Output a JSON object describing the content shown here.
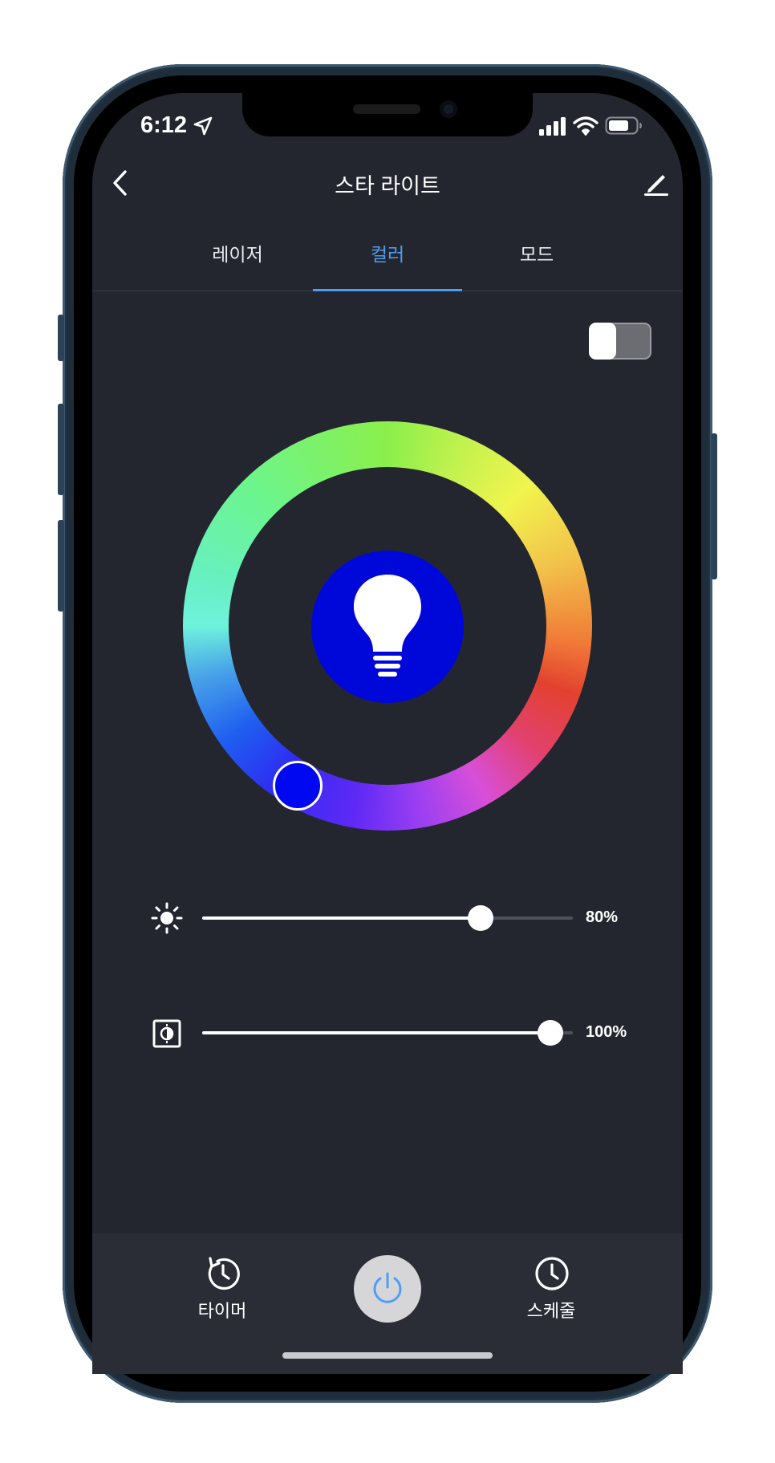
{
  "status_bar": {
    "time": "6:12"
  },
  "header": {
    "title": "스타 라이트"
  },
  "tabs": [
    {
      "label": "레이저",
      "active": false
    },
    {
      "label": "컬러",
      "active": true
    },
    {
      "label": "모드",
      "active": false
    }
  ],
  "power_toggle": {
    "on": false
  },
  "color_wheel": {
    "selected_color": "#0008f2",
    "bulb_color": "#0008d9"
  },
  "brightness": {
    "value": 0.8,
    "label": "80%"
  },
  "contrast": {
    "value": 1.0,
    "label": "100%"
  },
  "bottom_nav": {
    "timer_label": "타이머",
    "schedule_label": "스케줄"
  },
  "colors": {
    "accent": "#4f9ef2",
    "background": "#23262f"
  }
}
